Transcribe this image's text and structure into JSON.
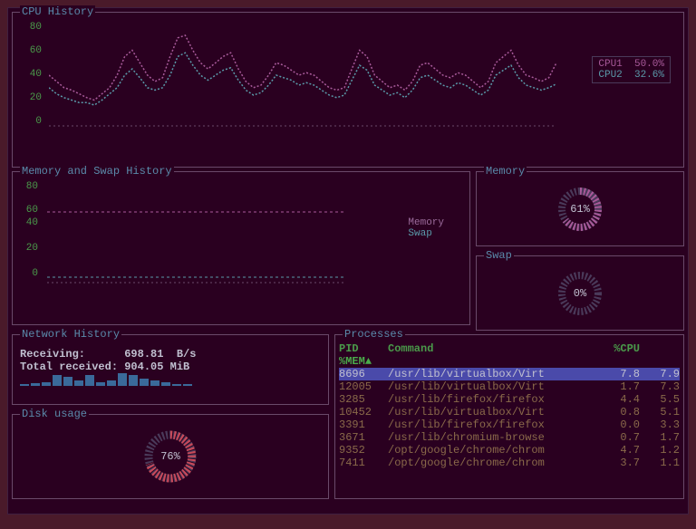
{
  "cpu": {
    "title": "CPU History",
    "yticks": [
      "80",
      "60",
      "40",
      "20",
      "0"
    ],
    "legend": [
      {
        "label": "CPU1",
        "value": "50.0%"
      },
      {
        "label": "CPU2",
        "value": "32.6%"
      }
    ]
  },
  "mem_history": {
    "title": "Memory and Swap History",
    "yticks": [
      "80",
      "60",
      "40",
      "20",
      "0"
    ],
    "legend": [
      {
        "label": "Memory"
      },
      {
        "label": "Swap"
      }
    ]
  },
  "memory": {
    "title": "Memory",
    "value": "61%"
  },
  "swap": {
    "title": "Swap",
    "value": "0%"
  },
  "network": {
    "title": "Network History",
    "receiving_label": "Receiving:",
    "receiving_value": "698.81  B/s",
    "total_label": "Total received:",
    "total_value": "904.05 MiB"
  },
  "disk": {
    "title": "Disk usage",
    "value": "76%"
  },
  "processes": {
    "title": "Processes",
    "headers": {
      "pid": "PID",
      "cmd": "Command",
      "cpu": "%CPU",
      "mem": "%MEM",
      "sort": "▲"
    },
    "rows": [
      {
        "pid": "8696",
        "cmd": "/usr/lib/virtualbox/Virt",
        "cpu": "7.8",
        "mem": "7.9",
        "selected": true
      },
      {
        "pid": "12005",
        "cmd": "/usr/lib/virtualbox/Virt",
        "cpu": "1.7",
        "mem": "7.3"
      },
      {
        "pid": "3285",
        "cmd": "/usr/lib/firefox/firefox",
        "cpu": "4.4",
        "mem": "5.5"
      },
      {
        "pid": "10452",
        "cmd": "/usr/lib/virtualbox/Virt",
        "cpu": "0.8",
        "mem": "5.1"
      },
      {
        "pid": "3391",
        "cmd": "/usr/lib/firefox/firefox",
        "cpu": "0.0",
        "mem": "3.3"
      },
      {
        "pid": "3671",
        "cmd": "/usr/lib/chromium-browse",
        "cpu": "0.7",
        "mem": "1.7"
      },
      {
        "pid": "9352",
        "cmd": "/opt/google/chrome/chrom",
        "cpu": "4.7",
        "mem": "1.2"
      },
      {
        "pid": "7411",
        "cmd": "/opt/google/chrome/chrom",
        "cpu": "3.7",
        "mem": "1.1"
      }
    ]
  },
  "chart_data": [
    {
      "type": "line",
      "title": "CPU History",
      "ylabel": "%",
      "ylim": [
        0,
        80
      ],
      "series": [
        {
          "name": "CPU1",
          "values": [
            40,
            35,
            30,
            28,
            25,
            22,
            20,
            25,
            30,
            40,
            55,
            60,
            50,
            40,
            35,
            38,
            55,
            70,
            72,
            60,
            50,
            45,
            50,
            55,
            58,
            45,
            35,
            30,
            32,
            40,
            50,
            48,
            44,
            40,
            42,
            40,
            35,
            30,
            28,
            30,
            45,
            60,
            55,
            40,
            35,
            30,
            32,
            28,
            35,
            48,
            50,
            45,
            40,
            38,
            42,
            40,
            35,
            30,
            35,
            50,
            55,
            60,
            48,
            40,
            38,
            35,
            38,
            50
          ]
        },
        {
          "name": "CPU2",
          "values": [
            30,
            25,
            22,
            20,
            18,
            18,
            16,
            20,
            25,
            30,
            40,
            45,
            38,
            30,
            28,
            30,
            40,
            55,
            58,
            48,
            40,
            36,
            40,
            44,
            46,
            36,
            28,
            24,
            26,
            32,
            40,
            38,
            36,
            32,
            34,
            32,
            28,
            24,
            22,
            24,
            36,
            48,
            44,
            32,
            28,
            24,
            26,
            22,
            28,
            38,
            40,
            36,
            32,
            30,
            34,
            32,
            28,
            24,
            28,
            40,
            44,
            48,
            38,
            32,
            30,
            28,
            30,
            33
          ]
        }
      ]
    },
    {
      "type": "line",
      "title": "Memory and Swap History",
      "ylim": [
        0,
        80
      ],
      "series": [
        {
          "name": "Memory",
          "values": [
            60,
            60,
            60,
            60,
            60,
            60,
            60,
            60,
            60,
            60,
            60,
            60,
            60,
            60,
            60,
            60,
            60,
            60,
            60,
            60,
            60,
            60,
            60,
            60,
            60,
            60,
            60,
            60,
            60,
            60,
            60,
            60,
            60,
            60,
            60,
            60,
            60,
            60,
            60,
            61
          ]
        },
        {
          "name": "Swap",
          "values": [
            0,
            0,
            0,
            0,
            0,
            0,
            0,
            0,
            0,
            0,
            0,
            0,
            0,
            0,
            0,
            0,
            0,
            0,
            0,
            0,
            0,
            0,
            0,
            0,
            0,
            0,
            0,
            0,
            0,
            0,
            0,
            0,
            0,
            0,
            0,
            0,
            0,
            0,
            0,
            0
          ]
        }
      ]
    },
    {
      "type": "pie",
      "title": "Memory",
      "values": [
        61,
        39
      ]
    },
    {
      "type": "pie",
      "title": "Swap",
      "values": [
        0,
        100
      ]
    },
    {
      "type": "pie",
      "title": "Disk usage",
      "values": [
        76,
        24
      ]
    },
    {
      "type": "bar",
      "title": "Network History",
      "values": [
        2,
        3,
        4,
        12,
        10,
        6,
        12,
        4,
        6,
        14,
        12,
        8,
        6,
        4,
        2,
        2
      ]
    }
  ]
}
